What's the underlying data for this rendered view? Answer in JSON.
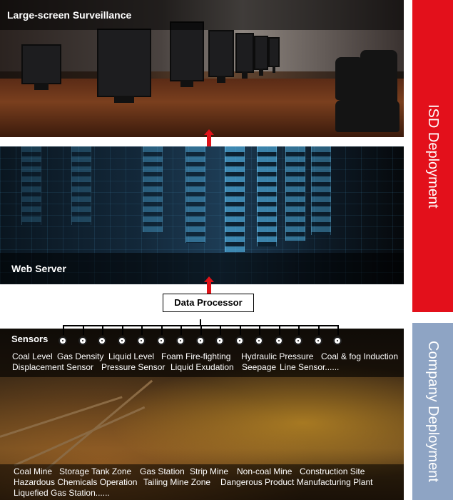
{
  "panels": {
    "screen_title": "Large-screen Surveillance",
    "server_title": "Web Server",
    "processor_label": "Data Processor"
  },
  "sensors": {
    "title": "Sensors",
    "row1": [
      "Coal Level",
      "Gas Density",
      "Liquid Level",
      "Foam Fire-fighting",
      "Hydraulic Pressure",
      "Coal & fog Induction"
    ],
    "row2": [
      "Displacement Sensor",
      "Pressure Sensor",
      "Liquid Exudation",
      "Seepage",
      "Line Sensor......"
    ]
  },
  "sites": {
    "row1": [
      "Coal Mine",
      "Storage Tank Zone",
      "Gas Station",
      "Strip Mine",
      "Non-coal Mine",
      "Construction Site"
    ],
    "row2": [
      "Hazardous Chemicals Operation",
      "Tailing Mine Zone",
      "Dangerous Product Manufacturing Plant"
    ],
    "row3": [
      "Liquefied Gas Station......"
    ]
  },
  "side_labels": {
    "isd": "ISD Deployment",
    "company": "Company Deployment"
  },
  "colors": {
    "accent_red": "#e3101b",
    "arrow_red": "#e01218",
    "company_blue": "#8ea4c4"
  },
  "icons": {
    "arrow": "up-arrow-icon",
    "sensor_node": "sensor-dot-icon"
  }
}
